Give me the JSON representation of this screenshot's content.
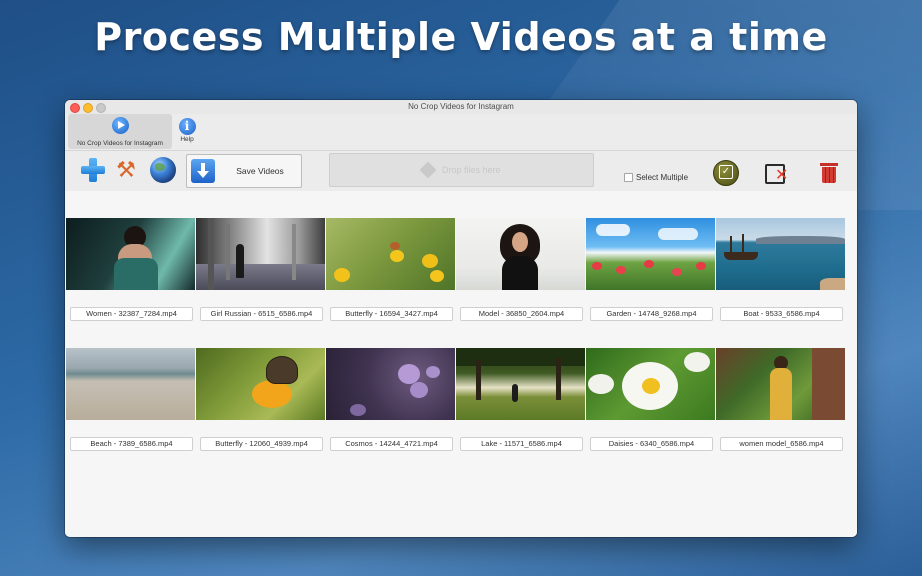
{
  "headline": "Process Multiple Videos at a time",
  "window": {
    "title": "No Crop Videos for Instagram"
  },
  "tabs": {
    "main_label": "No Crop Videos for Instagram",
    "help_label": "Help",
    "help_glyph": "i"
  },
  "toolbar": {
    "save_label": "Save Videos",
    "drop_label": "Drop files here",
    "select_multiple_label": "Select Multiple",
    "tools_glyph": "⚒"
  },
  "icons": {
    "add": "plus-icon",
    "settings": "tools-icon",
    "web": "globe-icon",
    "save": "download-icon",
    "check_all": "check-all-icon",
    "uncheck_all": "uncheck-icon",
    "delete": "trash-icon"
  },
  "colors": {
    "accent_blue": "#1f7fd6",
    "delete_red": "#d23c32",
    "check_olive": "#6b6c22"
  },
  "videos": [
    {
      "file": "Women - 32387_7284.mp4"
    },
    {
      "file": "Girl Russian - 6515_6586.mp4"
    },
    {
      "file": "Butterfly - 16594_3427.mp4"
    },
    {
      "file": "Model - 36850_2604.mp4"
    },
    {
      "file": "Garden - 14748_9268.mp4"
    },
    {
      "file": "Boat - 9533_6586.mp4"
    },
    {
      "file": "Beach - 7389_6586.mp4"
    },
    {
      "file": "Butterfly - 12060_4939.mp4"
    },
    {
      "file": "Cosmos - 14244_4721.mp4"
    },
    {
      "file": "Lake - 11571_6586.mp4"
    },
    {
      "file": "Daisies - 6340_6586.mp4"
    },
    {
      "file": "women model_6586.mp4"
    }
  ]
}
